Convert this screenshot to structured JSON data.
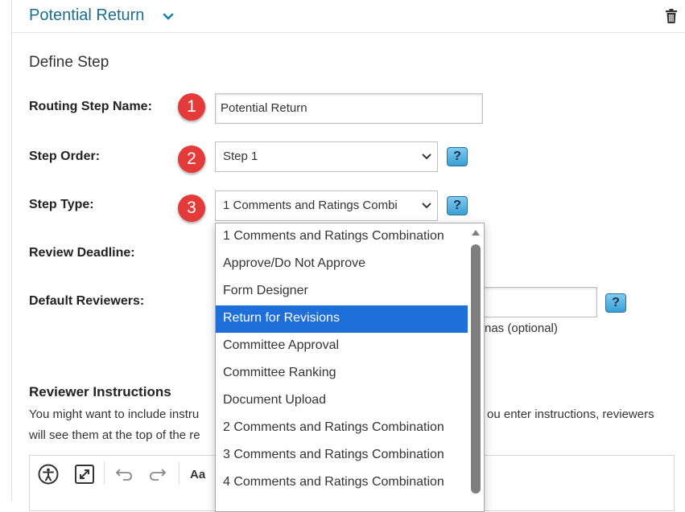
{
  "header": {
    "title": "Potential Return"
  },
  "section": {
    "title": "Define Step"
  },
  "fields": {
    "routing_step_name": {
      "label": "Routing Step Name:",
      "value": "Potential Return",
      "badge": "1"
    },
    "step_order": {
      "label": "Step Order:",
      "value": "Step 1",
      "badge": "2",
      "help": "?"
    },
    "step_type": {
      "label": "Step Type:",
      "value": "1 Comments and Ratings Combi",
      "badge": "3",
      "help": "?"
    },
    "review_deadline": {
      "label": "Review Deadline:"
    },
    "default_reviewers": {
      "label": "Default Reviewers:",
      "help": "?",
      "hint_visible": "nas (optional)"
    }
  },
  "reviewer_instructions": {
    "title": "Reviewer Instructions",
    "line1_left": "You might want to include instru",
    "line1_right": "ou enter instructions, reviewers",
    "line2_left": "will see them at the top of the re"
  },
  "editor_toolbar": {
    "font_label": "Aa",
    "icons": [
      "accessibility-icon",
      "fullscreen-icon",
      "undo-icon",
      "redo-icon",
      "font-size-icon"
    ]
  },
  "dropdown": {
    "selected_index": 3,
    "options": [
      "1 Comments and Ratings Combination",
      "Approve/Do Not Approve",
      "Form Designer",
      "Return for Revisions",
      "Committee Approval",
      "Committee Ranking",
      "Document Upload",
      "2 Comments and Ratings Combination",
      "3 Comments and Ratings Combination",
      "4 Comments and Ratings Combination"
    ]
  },
  "colors": {
    "accent": "#1a6e8e",
    "badge": "#e53a3a",
    "selected": "#1e6fd9"
  }
}
